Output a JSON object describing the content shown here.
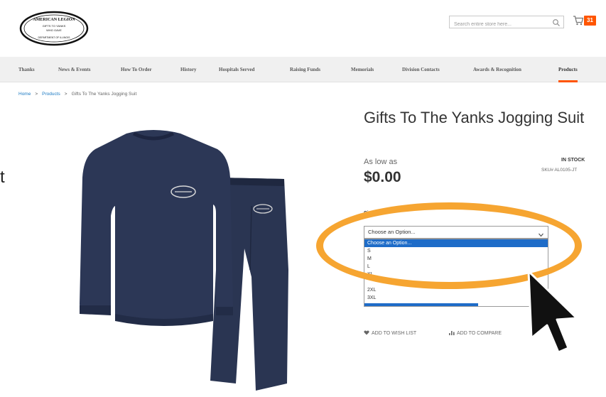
{
  "header": {
    "logo": {
      "line1": "AMERICAN LEGION",
      "line2": "GIFTS TO YANKS",
      "line3": "WHO GAVE",
      "line4": "DEPARTMENT OF ILLINOIS"
    },
    "search_placeholder": "Search entire store here...",
    "cart_count": "31"
  },
  "nav": {
    "items": [
      {
        "label": "Thanks"
      },
      {
        "label": "News & Events"
      },
      {
        "label": "How To Order"
      },
      {
        "label": "History"
      },
      {
        "label": "Hospitals Served"
      },
      {
        "label": "Raising Funds"
      },
      {
        "label": "Memorials"
      },
      {
        "label": "Division Contacts"
      },
      {
        "label": "Awards & Recognition"
      },
      {
        "label": "Products"
      }
    ],
    "active": "Products"
  },
  "breadcrumb": {
    "home": "Home",
    "products": "Products",
    "current": "Gifts To The Yanks Jogging Suit",
    "sep": ">"
  },
  "side_text": "t",
  "product": {
    "title": "Gifts To The Yanks Jogging Suit",
    "as_low_as": "As low as",
    "price": "$0.00",
    "stock": "IN STOCK",
    "sku": "SKU# AL0105-JT"
  },
  "options": {
    "label": "Size *",
    "selected": "Choose an Option...",
    "list": [
      "Choose an Option...",
      "S",
      "M",
      "L",
      "XL",
      "",
      "2XL",
      "3XL"
    ]
  },
  "actions": {
    "wishlist": "ADD TO WISH LIST",
    "compare": "ADD TO COMPARE"
  },
  "colors": {
    "accent": "#ff5501",
    "highlight": "#f6a531",
    "link": "#1979c3",
    "selection": "#1e6cc8",
    "garment": "#28334f"
  }
}
